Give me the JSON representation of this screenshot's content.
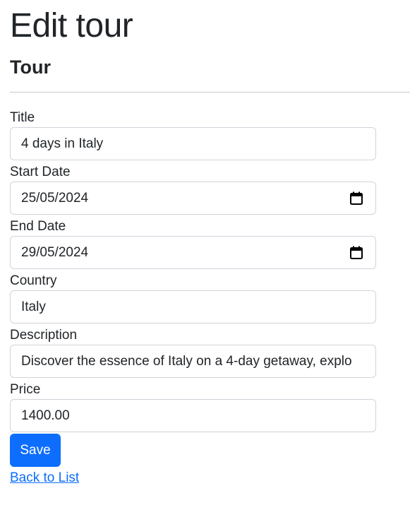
{
  "page": {
    "title": "Edit tour",
    "section_title": "Tour"
  },
  "form": {
    "fields": [
      {
        "label": "Title",
        "value": "4 days in Italy",
        "type": "text"
      },
      {
        "label": "Start Date",
        "value": "25/05/2024",
        "type": "date"
      },
      {
        "label": "End Date",
        "value": "29/05/2024",
        "type": "date"
      },
      {
        "label": "Country",
        "value": "Italy",
        "type": "text"
      },
      {
        "label": "Description",
        "value": "Discover the essence of Italy on a 4-day getaway, explo",
        "type": "text"
      },
      {
        "label": "Price",
        "value": "1400.00",
        "type": "text"
      }
    ],
    "save_label": "Save"
  },
  "links": {
    "back_label": "Back to List"
  },
  "colors": {
    "primary": "#0d6efd",
    "text": "#212529",
    "border": "#ced4da"
  },
  "icons": {
    "date_picker": "calendar-icon"
  }
}
